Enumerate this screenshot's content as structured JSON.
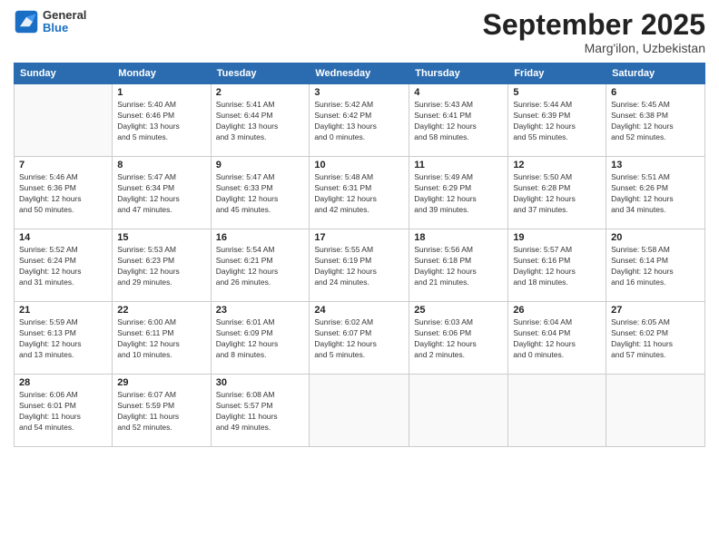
{
  "logo": {
    "general": "General",
    "blue": "Blue"
  },
  "header": {
    "month": "September 2025",
    "location": "Marg'ilon, Uzbekistan"
  },
  "weekdays": [
    "Sunday",
    "Monday",
    "Tuesday",
    "Wednesday",
    "Thursday",
    "Friday",
    "Saturday"
  ],
  "weeks": [
    [
      {
        "day": "",
        "info": ""
      },
      {
        "day": "1",
        "info": "Sunrise: 5:40 AM\nSunset: 6:46 PM\nDaylight: 13 hours\nand 5 minutes."
      },
      {
        "day": "2",
        "info": "Sunrise: 5:41 AM\nSunset: 6:44 PM\nDaylight: 13 hours\nand 3 minutes."
      },
      {
        "day": "3",
        "info": "Sunrise: 5:42 AM\nSunset: 6:42 PM\nDaylight: 13 hours\nand 0 minutes."
      },
      {
        "day": "4",
        "info": "Sunrise: 5:43 AM\nSunset: 6:41 PM\nDaylight: 12 hours\nand 58 minutes."
      },
      {
        "day": "5",
        "info": "Sunrise: 5:44 AM\nSunset: 6:39 PM\nDaylight: 12 hours\nand 55 minutes."
      },
      {
        "day": "6",
        "info": "Sunrise: 5:45 AM\nSunset: 6:38 PM\nDaylight: 12 hours\nand 52 minutes."
      }
    ],
    [
      {
        "day": "7",
        "info": "Sunrise: 5:46 AM\nSunset: 6:36 PM\nDaylight: 12 hours\nand 50 minutes."
      },
      {
        "day": "8",
        "info": "Sunrise: 5:47 AM\nSunset: 6:34 PM\nDaylight: 12 hours\nand 47 minutes."
      },
      {
        "day": "9",
        "info": "Sunrise: 5:47 AM\nSunset: 6:33 PM\nDaylight: 12 hours\nand 45 minutes."
      },
      {
        "day": "10",
        "info": "Sunrise: 5:48 AM\nSunset: 6:31 PM\nDaylight: 12 hours\nand 42 minutes."
      },
      {
        "day": "11",
        "info": "Sunrise: 5:49 AM\nSunset: 6:29 PM\nDaylight: 12 hours\nand 39 minutes."
      },
      {
        "day": "12",
        "info": "Sunrise: 5:50 AM\nSunset: 6:28 PM\nDaylight: 12 hours\nand 37 minutes."
      },
      {
        "day": "13",
        "info": "Sunrise: 5:51 AM\nSunset: 6:26 PM\nDaylight: 12 hours\nand 34 minutes."
      }
    ],
    [
      {
        "day": "14",
        "info": "Sunrise: 5:52 AM\nSunset: 6:24 PM\nDaylight: 12 hours\nand 31 minutes."
      },
      {
        "day": "15",
        "info": "Sunrise: 5:53 AM\nSunset: 6:23 PM\nDaylight: 12 hours\nand 29 minutes."
      },
      {
        "day": "16",
        "info": "Sunrise: 5:54 AM\nSunset: 6:21 PM\nDaylight: 12 hours\nand 26 minutes."
      },
      {
        "day": "17",
        "info": "Sunrise: 5:55 AM\nSunset: 6:19 PM\nDaylight: 12 hours\nand 24 minutes."
      },
      {
        "day": "18",
        "info": "Sunrise: 5:56 AM\nSunset: 6:18 PM\nDaylight: 12 hours\nand 21 minutes."
      },
      {
        "day": "19",
        "info": "Sunrise: 5:57 AM\nSunset: 6:16 PM\nDaylight: 12 hours\nand 18 minutes."
      },
      {
        "day": "20",
        "info": "Sunrise: 5:58 AM\nSunset: 6:14 PM\nDaylight: 12 hours\nand 16 minutes."
      }
    ],
    [
      {
        "day": "21",
        "info": "Sunrise: 5:59 AM\nSunset: 6:13 PM\nDaylight: 12 hours\nand 13 minutes."
      },
      {
        "day": "22",
        "info": "Sunrise: 6:00 AM\nSunset: 6:11 PM\nDaylight: 12 hours\nand 10 minutes."
      },
      {
        "day": "23",
        "info": "Sunrise: 6:01 AM\nSunset: 6:09 PM\nDaylight: 12 hours\nand 8 minutes."
      },
      {
        "day": "24",
        "info": "Sunrise: 6:02 AM\nSunset: 6:07 PM\nDaylight: 12 hours\nand 5 minutes."
      },
      {
        "day": "25",
        "info": "Sunrise: 6:03 AM\nSunset: 6:06 PM\nDaylight: 12 hours\nand 2 minutes."
      },
      {
        "day": "26",
        "info": "Sunrise: 6:04 AM\nSunset: 6:04 PM\nDaylight: 12 hours\nand 0 minutes."
      },
      {
        "day": "27",
        "info": "Sunrise: 6:05 AM\nSunset: 6:02 PM\nDaylight: 11 hours\nand 57 minutes."
      }
    ],
    [
      {
        "day": "28",
        "info": "Sunrise: 6:06 AM\nSunset: 6:01 PM\nDaylight: 11 hours\nand 54 minutes."
      },
      {
        "day": "29",
        "info": "Sunrise: 6:07 AM\nSunset: 5:59 PM\nDaylight: 11 hours\nand 52 minutes."
      },
      {
        "day": "30",
        "info": "Sunrise: 6:08 AM\nSunset: 5:57 PM\nDaylight: 11 hours\nand 49 minutes."
      },
      {
        "day": "",
        "info": ""
      },
      {
        "day": "",
        "info": ""
      },
      {
        "day": "",
        "info": ""
      },
      {
        "day": "",
        "info": ""
      }
    ]
  ]
}
